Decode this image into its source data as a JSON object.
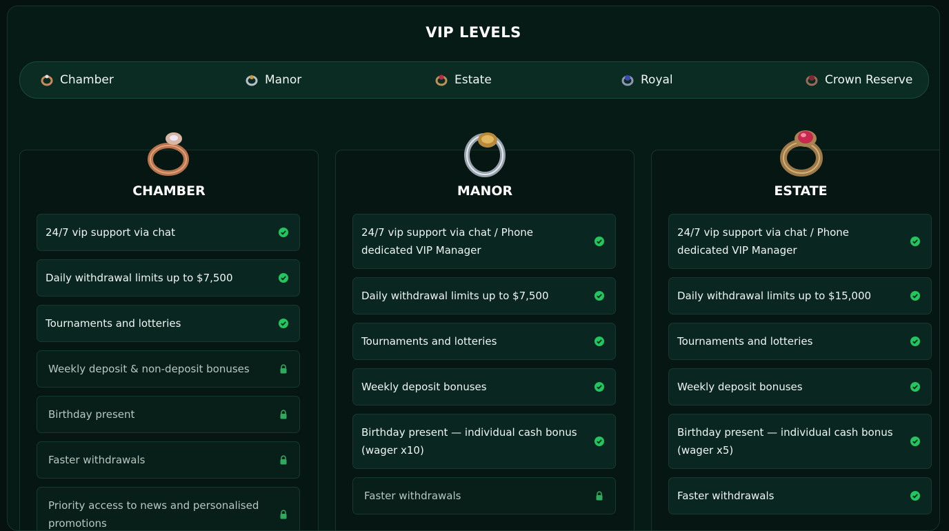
{
  "title": "VIP LEVELS",
  "tabs": [
    {
      "label": "Chamber",
      "icon": "chamber-ring-icon"
    },
    {
      "label": "Manor",
      "icon": "manor-ring-icon"
    },
    {
      "label": "Estate",
      "icon": "estate-ring-icon"
    },
    {
      "label": "Royal",
      "icon": "royal-ring-icon"
    },
    {
      "label": "Crown Reserve",
      "icon": "crown-reserve-ring-icon"
    }
  ],
  "colors": {
    "accent_green": "#22c55e",
    "lock_green": "#2faa5c",
    "background": "#06120f"
  },
  "cards": [
    {
      "name": "CHAMBER",
      "features": [
        {
          "text": "24/7 vip support via chat",
          "status": "check"
        },
        {
          "text": "Daily withdrawal limits up to $7,500",
          "status": "check"
        },
        {
          "text": "Tournaments and lotteries",
          "status": "check"
        },
        {
          "text": "Weekly deposit & non-deposit bonuses",
          "status": "lock"
        },
        {
          "text": "Birthday present",
          "status": "lock"
        },
        {
          "text": "Faster withdrawals",
          "status": "lock"
        },
        {
          "text": "Priority access to news and personalised promotions",
          "status": "lock"
        }
      ]
    },
    {
      "name": "MANOR",
      "features": [
        {
          "text": "24/7 vip support via chat / Phone dedicated VIP Manager",
          "status": "check"
        },
        {
          "text": "Daily withdrawal limits up to $7,500",
          "status": "check"
        },
        {
          "text": "Tournaments and lotteries",
          "status": "check"
        },
        {
          "text": "Weekly deposit bonuses",
          "status": "check"
        },
        {
          "text": "Birthday present — individual cash bonus (wager x10)",
          "status": "check"
        },
        {
          "text": "Faster withdrawals",
          "status": "lock"
        }
      ]
    },
    {
      "name": "ESTATE",
      "features": [
        {
          "text": "24/7 vip support via chat / Phone dedicated VIP Manager",
          "status": "check"
        },
        {
          "text": "Daily withdrawal limits up to $15,000",
          "status": "check"
        },
        {
          "text": "Tournaments and lotteries",
          "status": "check"
        },
        {
          "text": "Weekly deposit bonuses",
          "status": "check"
        },
        {
          "text": "Birthday present — individual cash bonus (wager x5)",
          "status": "check"
        },
        {
          "text": "Faster withdrawals",
          "status": "check"
        }
      ]
    }
  ]
}
